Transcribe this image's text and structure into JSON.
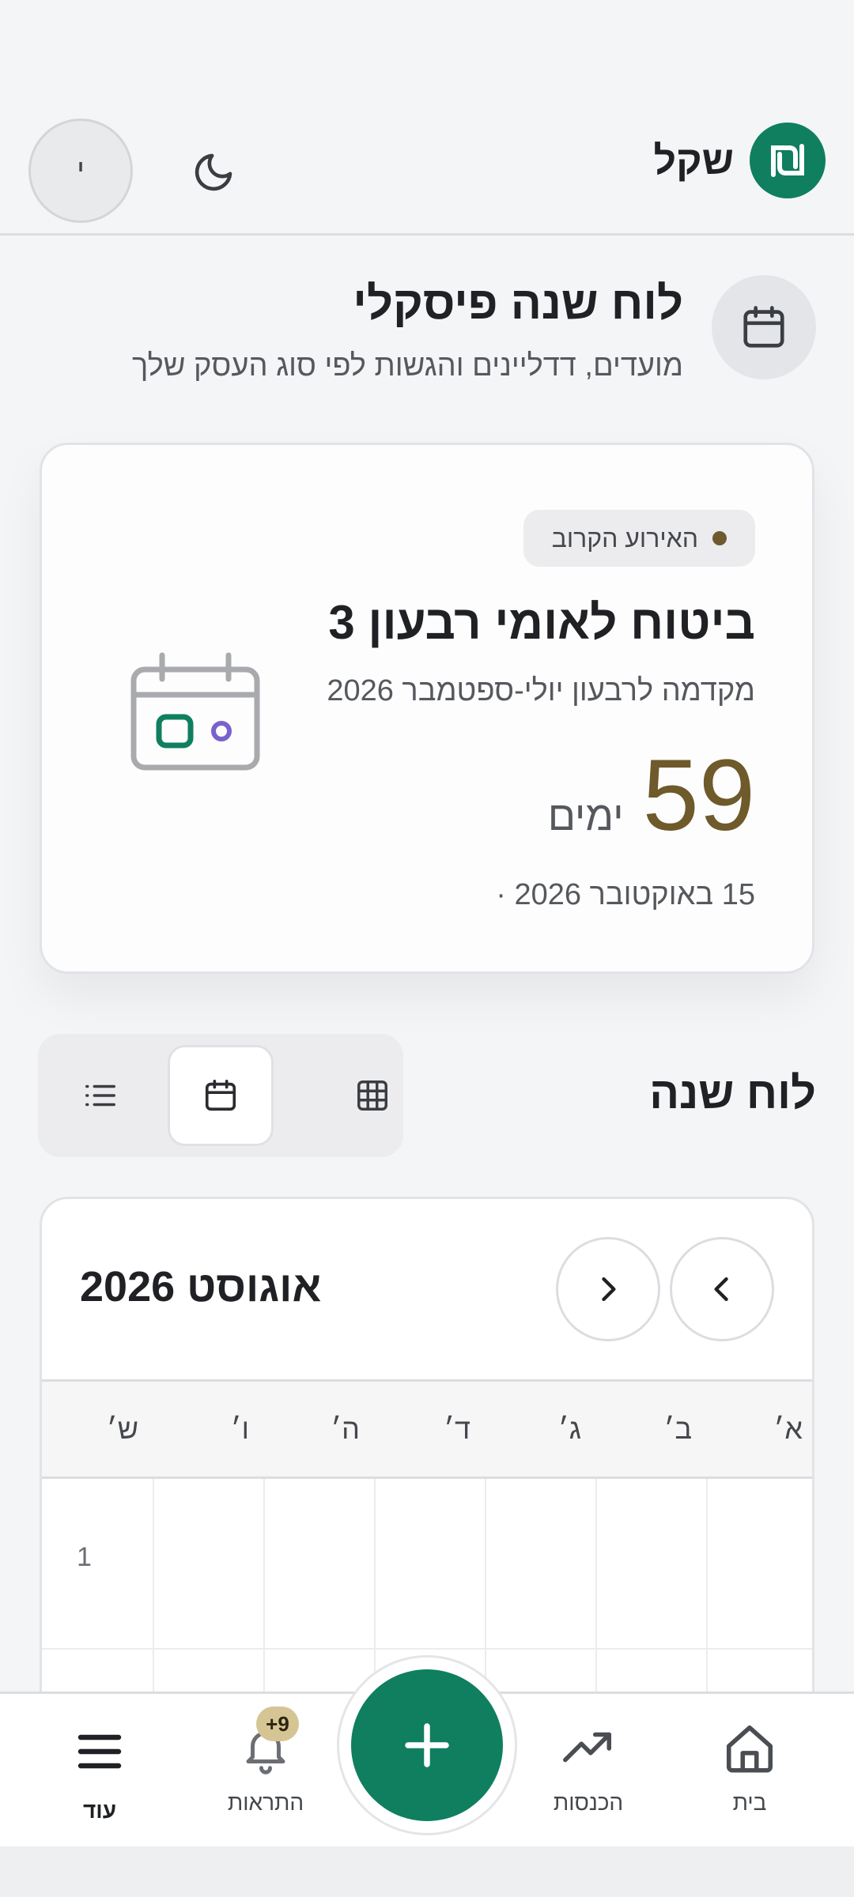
{
  "header": {
    "brand_name": "שקל",
    "brand_logo_glyph": "₪",
    "avatar_initial": "י",
    "theme_toggle_icon": "moon-icon"
  },
  "page": {
    "title": "לוח שנה פיסקלי",
    "subtitle": "מועדים, דדליינים והגשות לפי סוג העסק שלך",
    "icon": "calendar-icon"
  },
  "next_event": {
    "badge_label": "האירוע הקרוב",
    "title": "ביטוח לאומי רבעון 3",
    "description": "מקדמה לרבעון יולי-ספטמבר 2026",
    "days_count": "59",
    "days_unit": "ימים",
    "date_text": "15 באוקטובר 2026 ·",
    "colors": {
      "accent": "#6e5a2a",
      "dot": "#6e5a2e"
    }
  },
  "year_calendar": {
    "section_title": "לוח שנה",
    "views": [
      {
        "name": "grid",
        "icon": "grid-icon",
        "active": false
      },
      {
        "name": "calendar",
        "icon": "calendar-icon",
        "active": true
      },
      {
        "name": "list",
        "icon": "list-icon",
        "active": false
      }
    ]
  },
  "month": {
    "label": "אוגוסט 2026",
    "weekdays": [
      "א׳",
      "ב׳",
      "ג׳",
      "ד׳",
      "ה׳",
      "ו׳",
      "ש׳"
    ],
    "first_row": [
      "",
      "",
      "",
      "",
      "",
      "",
      "1"
    ]
  },
  "bottom_nav": {
    "items": [
      {
        "label": "בית",
        "icon": "home-icon"
      },
      {
        "label": "הכנסות",
        "icon": "trending-up-icon"
      },
      {
        "label": "התראות",
        "icon": "bell-icon",
        "badge": "+9"
      },
      {
        "label": "עוד",
        "icon": "menu-icon",
        "active": true
      }
    ],
    "fab_icon": "plus-icon",
    "colors": {
      "primary": "#0f7f5f"
    }
  }
}
